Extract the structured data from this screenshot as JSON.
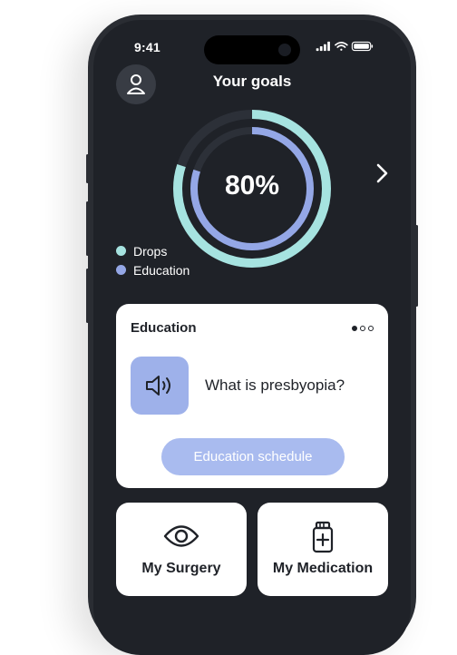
{
  "status_bar": {
    "time": "9:41"
  },
  "header": {
    "title": "Your goals"
  },
  "goals": {
    "progress_label": "80%",
    "drops_progress": 0.8,
    "education_progress": 0.8,
    "legend": [
      {
        "label": "Drops",
        "color": "#a6e3e0"
      },
      {
        "label": "Education",
        "color": "#94a7e6"
      }
    ]
  },
  "education_card": {
    "title": "Education",
    "item_title": "What is presbyopia?",
    "button_label": "Education schedule",
    "pager_total": 3,
    "pager_active": 1
  },
  "tiles": [
    {
      "label": "My Surgery",
      "icon": "eye-icon"
    },
    {
      "label": "My Medication",
      "icon": "medication-bottle-icon"
    }
  ],
  "colors": {
    "background": "#1f2228",
    "card": "#ffffff",
    "accent_blue": "#94a7e6",
    "accent_teal": "#a6e3e0",
    "button": "#a9bbef"
  }
}
